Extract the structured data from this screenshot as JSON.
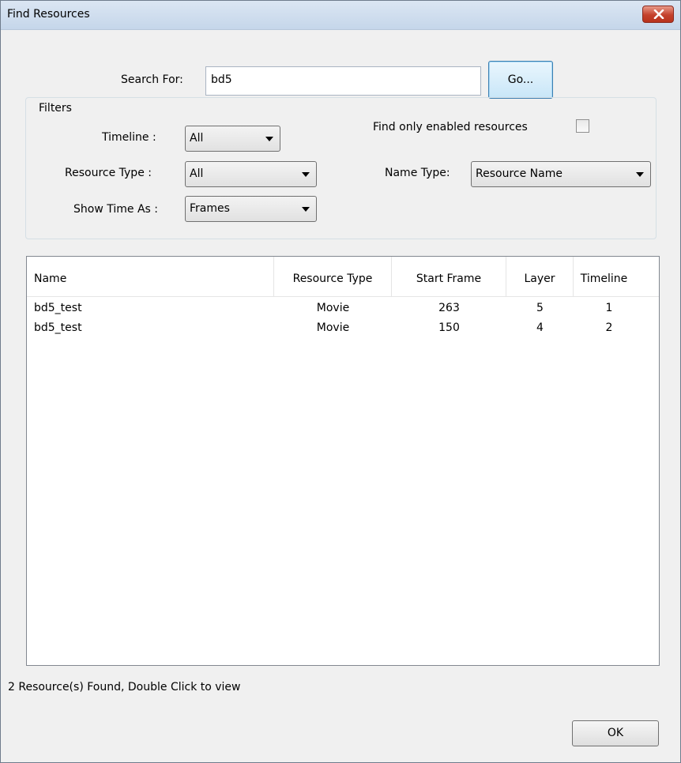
{
  "window": {
    "title": "Find Resources",
    "close_icon": "close-icon"
  },
  "search": {
    "label": "Search For:",
    "value": "bd5",
    "go_label": "Go..."
  },
  "filters": {
    "legend": "Filters",
    "timeline_label": "Timeline :",
    "timeline_value": "All",
    "resource_type_label": "Resource Type :",
    "resource_type_value": "All",
    "show_time_label": "Show Time As :",
    "show_time_value": "Frames",
    "enabled_only_label": "Find only enabled resources",
    "enabled_only_checked": false,
    "name_type_label": "Name Type:",
    "name_type_value": "Resource Name"
  },
  "results": {
    "columns": [
      "Name",
      "Resource Type",
      "Start Frame",
      "Layer",
      "Timeline"
    ],
    "rows": [
      [
        "bd5_test",
        "Movie",
        "263",
        "5",
        "1"
      ],
      [
        "bd5_test",
        "Movie",
        "150",
        "4",
        "2"
      ]
    ]
  },
  "status": "2 Resource(s) Found, Double Click to view",
  "ok_label": "OK"
}
